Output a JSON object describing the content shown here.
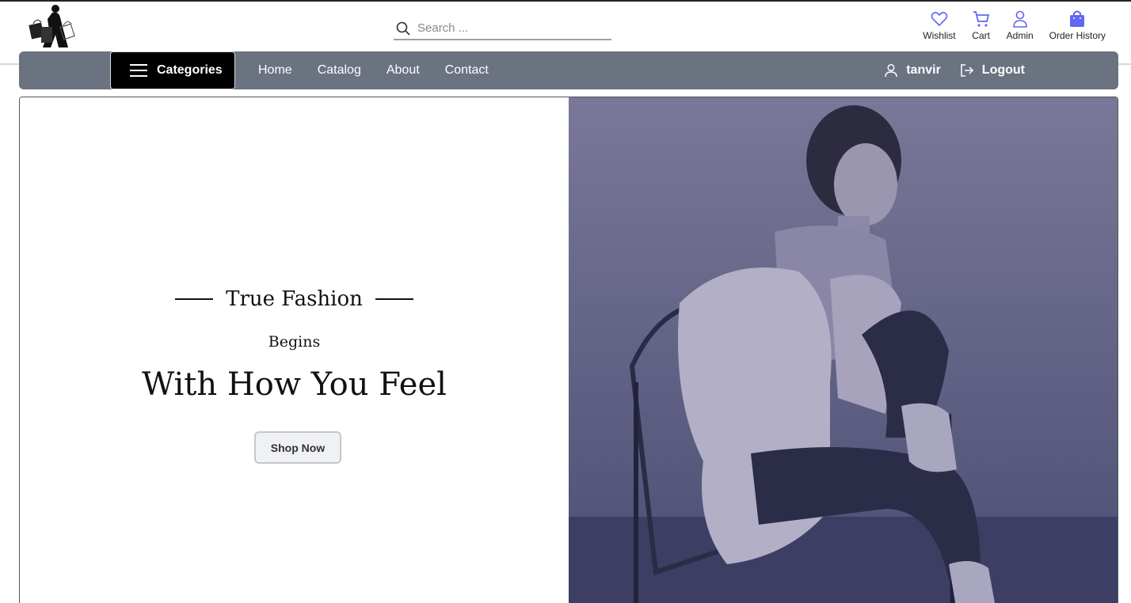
{
  "header": {
    "logo_icon": "shopping-lady-logo",
    "search": {
      "placeholder": "Search ...",
      "value": ""
    },
    "actions": [
      {
        "label": "Wishlist",
        "icon": "heart-icon"
      },
      {
        "label": "Cart",
        "icon": "cart-icon"
      },
      {
        "label": "Admin",
        "icon": "user-icon"
      },
      {
        "label": "Order History",
        "icon": "shopping-bag-icon"
      }
    ]
  },
  "nav": {
    "categories_label": "Categories",
    "links": [
      "Home",
      "Catalog",
      "About",
      "Contact"
    ],
    "username": "tanvir",
    "logout_label": "Logout"
  },
  "hero": {
    "tagline": "True Fashion",
    "sub": "Begins",
    "headline": "With How You Feel",
    "button_label": "Shop Now",
    "image_icon": "fashion-model-photo"
  },
  "colors": {
    "nav_bg": "#6b7280",
    "categories_bg": "#000000",
    "accent": "#6366f1",
    "hero_image_tint": "#6b6e94"
  }
}
